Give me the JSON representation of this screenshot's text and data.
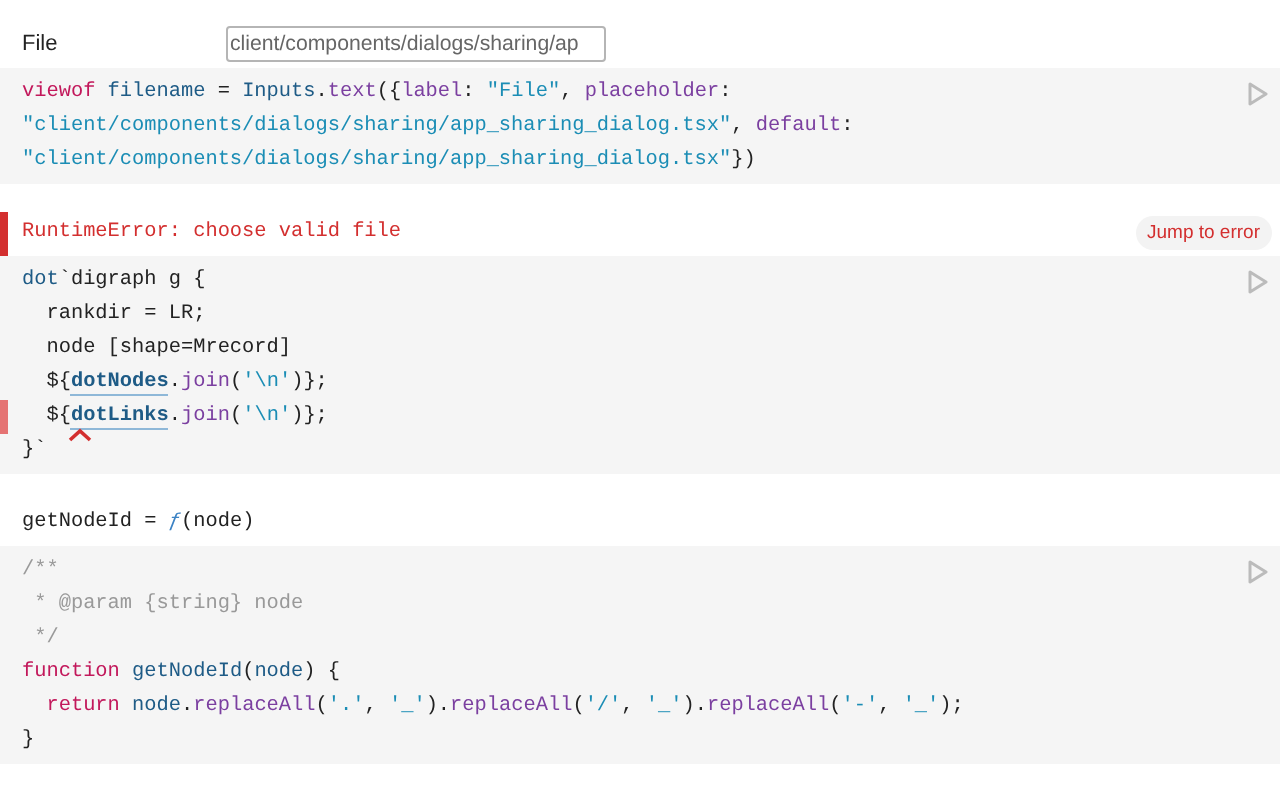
{
  "cells": [
    {
      "kind": "input",
      "label": "File",
      "value": "client/components/dialogs/sharing/ap",
      "code": [
        {
          "error": false,
          "tokens": [
            {
              "text": "viewof",
              "kind": "kw"
            },
            {
              "text": " filename",
              "kind": "var"
            },
            {
              "text": " = ",
              "kind": "p"
            },
            {
              "text": "Inputs",
              "kind": "var"
            },
            {
              "text": ".",
              "kind": "p"
            },
            {
              "text": "text",
              "kind": "prop"
            },
            {
              "text": "({",
              "kind": "p"
            },
            {
              "text": "label",
              "kind": "prop"
            },
            {
              "text": ": ",
              "kind": "p"
            },
            {
              "text": "\"File\"",
              "kind": "str"
            },
            {
              "text": ", ",
              "kind": "p"
            },
            {
              "text": "placeholder",
              "kind": "prop"
            },
            {
              "text": ":",
              "kind": "p"
            }
          ]
        },
        {
          "error": false,
          "tokens": [
            {
              "text": "\"client/components/dialogs/sharing/app_sharing_dialog.tsx\"",
              "kind": "str"
            },
            {
              "text": ", ",
              "kind": "p"
            },
            {
              "text": "default",
              "kind": "prop"
            },
            {
              "text": ":",
              "kind": "p"
            }
          ]
        },
        {
          "error": false,
          "tokens": [
            {
              "text": "\"client/components/dialogs/sharing/app_sharing_dialog.tsx\"",
              "kind": "str"
            },
            {
              "text": "})",
              "kind": "p"
            }
          ]
        }
      ]
    },
    {
      "kind": "error",
      "message": "RuntimeError: choose valid file",
      "button": "Jump to error",
      "code": [
        {
          "error": false,
          "tokens": [
            {
              "text": "dot",
              "kind": "var"
            },
            {
              "text": "`digraph g {",
              "kind": "p"
            }
          ]
        },
        {
          "error": false,
          "tokens": [
            {
              "text": "  rankdir = LR;",
              "kind": "p"
            }
          ]
        },
        {
          "error": false,
          "tokens": [
            {
              "text": "  node [shape=Mrecord]",
              "kind": "p"
            }
          ]
        },
        {
          "error": false,
          "tokens": [
            {
              "text": "  ${",
              "kind": "p"
            },
            {
              "text": "dotNodes",
              "kind": "ref"
            },
            {
              "text": ".",
              "kind": "p"
            },
            {
              "text": "join",
              "kind": "prop"
            },
            {
              "text": "(",
              "kind": "p"
            },
            {
              "text": "'\\n'",
              "kind": "str"
            },
            {
              "text": ")};",
              "kind": "p"
            }
          ]
        },
        {
          "error": true,
          "tokens": [
            {
              "text": "  ${",
              "kind": "p"
            },
            {
              "text": "dotLinks",
              "kind": "ref"
            },
            {
              "text": ".",
              "kind": "p"
            },
            {
              "text": "join",
              "kind": "prop"
            },
            {
              "text": "(",
              "kind": "p"
            },
            {
              "text": "'\\n'",
              "kind": "str"
            },
            {
              "text": ")};",
              "kind": "p"
            }
          ]
        },
        {
          "error": false,
          "tokens": [
            {
              "text": "}`",
              "kind": "p"
            }
          ]
        }
      ]
    },
    {
      "kind": "value",
      "output": [
        {
          "text": "getNodeId = ",
          "kind": "p"
        },
        {
          "text": "ƒ",
          "kind": "fn"
        },
        {
          "text": "(node)",
          "kind": "p"
        }
      ],
      "code": [
        {
          "error": false,
          "tokens": [
            {
              "text": "/**",
              "kind": "comment"
            }
          ]
        },
        {
          "error": false,
          "tokens": [
            {
              "text": " * @param {string} node",
              "kind": "comment"
            }
          ]
        },
        {
          "error": false,
          "tokens": [
            {
              "text": " */",
              "kind": "comment"
            }
          ]
        },
        {
          "error": false,
          "tokens": [
            {
              "text": "function",
              "kind": "kw"
            },
            {
              "text": " getNodeId",
              "kind": "var"
            },
            {
              "text": "(",
              "kind": "p"
            },
            {
              "text": "node",
              "kind": "var"
            },
            {
              "text": ") {",
              "kind": "p"
            }
          ]
        },
        {
          "error": false,
          "tokens": [
            {
              "text": "  return",
              "kind": "kw"
            },
            {
              "text": " node",
              "kind": "var"
            },
            {
              "text": ".",
              "kind": "p"
            },
            {
              "text": "replaceAll",
              "kind": "prop"
            },
            {
              "text": "(",
              "kind": "p"
            },
            {
              "text": "'.'",
              "kind": "str"
            },
            {
              "text": ", ",
              "kind": "p"
            },
            {
              "text": "'_'",
              "kind": "str"
            },
            {
              "text": ").",
              "kind": "p"
            },
            {
              "text": "replaceAll",
              "kind": "prop"
            },
            {
              "text": "(",
              "kind": "p"
            },
            {
              "text": "'/'",
              "kind": "str"
            },
            {
              "text": ", ",
              "kind": "p"
            },
            {
              "text": "'_'",
              "kind": "str"
            },
            {
              "text": ").",
              "kind": "p"
            },
            {
              "text": "replaceAll",
              "kind": "prop"
            },
            {
              "text": "(",
              "kind": "p"
            },
            {
              "text": "'-'",
              "kind": "str"
            },
            {
              "text": ", ",
              "kind": "p"
            },
            {
              "text": "'_'",
              "kind": "str"
            },
            {
              "text": ");",
              "kind": "p"
            }
          ]
        },
        {
          "error": false,
          "tokens": [
            {
              "text": "}",
              "kind": "p"
            }
          ]
        }
      ]
    }
  ]
}
